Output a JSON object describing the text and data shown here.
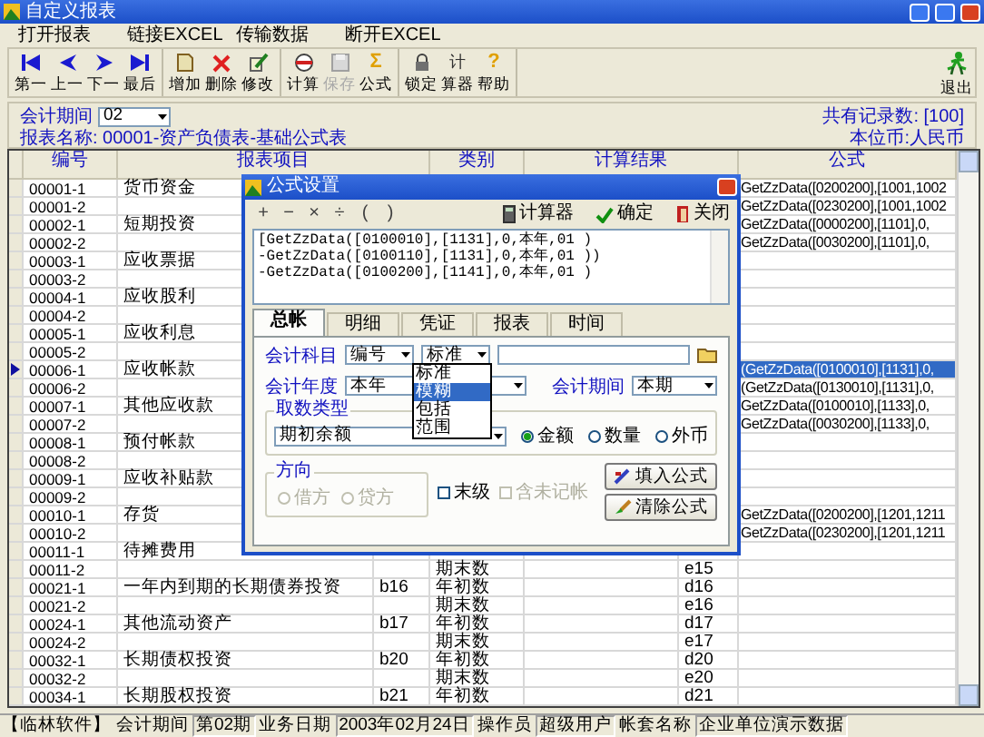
{
  "window": {
    "title": "自定义报表"
  },
  "menu": [
    "打开报表",
    "链接EXCEL",
    "传输数据",
    "断开EXCEL"
  ],
  "toolbar": {
    "groups": [
      [
        {
          "label": "第一",
          "disabled": false
        },
        {
          "label": "上一",
          "disabled": false
        },
        {
          "label": "下一",
          "disabled": false
        },
        {
          "label": "最后",
          "disabled": false
        }
      ],
      [
        {
          "label": "增加",
          "disabled": false
        },
        {
          "label": "删除",
          "disabled": false
        },
        {
          "label": "修改",
          "disabled": false
        }
      ],
      [
        {
          "label": "计算",
          "disabled": false
        },
        {
          "label": "保存",
          "disabled": true
        },
        {
          "label": "公式",
          "glyph": "Σ",
          "disabled": false
        }
      ],
      [
        {
          "label": "锁定",
          "disabled": false
        },
        {
          "label": "算器",
          "glyph": "计",
          "disabled": false
        },
        {
          "label": "帮助",
          "glyph": "?",
          "disabled": false
        }
      ]
    ],
    "exit": {
      "label": "退出"
    }
  },
  "info": {
    "period_label": "会计期间",
    "period": "02",
    "record_count": "共有记录数: [100]",
    "report_name": "报表名称: 00001-资产负债表-基础公式表",
    "currency": "本位币:人民币"
  },
  "table": {
    "columns": [
      "编号",
      "报表项目",
      "类别",
      "计算结果",
      "公式"
    ],
    "rows": [
      {
        "id": "00001-1",
        "item": "货币资金",
        "formula": "GetZzData([0200200],[1001,1002",
        "selected": false
      },
      {
        "id": "00001-2",
        "formula": "GetZzData([0230200],[1001,1002",
        "selected": false
      },
      {
        "id": "00002-1",
        "item": "短期投资",
        "formula": "GetZzData([0000200],[1101],0,",
        "selected": false
      },
      {
        "id": "00002-2",
        "formula": "GetZzData([0030200],[1101],0,",
        "selected": false
      },
      {
        "id": "00003-1",
        "item": "应收票据",
        "selected": false
      },
      {
        "id": "00003-2",
        "selected": false
      },
      {
        "id": "00004-1",
        "item": "应收股利",
        "selected": false
      },
      {
        "id": "00004-2",
        "selected": false
      },
      {
        "id": "00005-1",
        "item": "应收利息",
        "selected": false
      },
      {
        "id": "00005-2",
        "selected": false
      },
      {
        "id": "00006-1",
        "item": "应收帐款",
        "formula": "(GetZzData([0100010],[1131],0,",
        "selected": true
      },
      {
        "id": "00006-2",
        "formula": "(GetZzData([0130010],[1131],0,",
        "selected": false
      },
      {
        "id": "00007-1",
        "item": "其他应收款",
        "formula": "GetZzData([0100010],[1133],0,",
        "selected": false
      },
      {
        "id": "00007-2",
        "formula": "GetZzData([0030200],[1133],0,",
        "selected": false
      },
      {
        "id": "00008-1",
        "item": "预付帐款",
        "selected": false
      },
      {
        "id": "00008-2",
        "selected": false
      },
      {
        "id": "00009-1",
        "item": "应收补贴款",
        "selected": false
      },
      {
        "id": "00009-2",
        "selected": false
      },
      {
        "id": "00010-1",
        "item": "存货",
        "formula": "GetZzData([0200200],[1201,1211",
        "selected": false
      },
      {
        "id": "00010-2",
        "formula": "GetZzData([0230200],[1201,1211",
        "selected": false
      },
      {
        "id": "00011-1",
        "item": "待摊费用",
        "selected": false
      },
      {
        "id": "00011-2",
        "category": "期末数",
        "column_6": "e15",
        "selected": false
      },
      {
        "id": "00021-1",
        "item": "一年内到期的长期债券投资",
        "column_3": "b16",
        "category": "年初数",
        "column_6": "d16",
        "selected": false
      },
      {
        "id": "00021-2",
        "category": "期末数",
        "column_6": "e16",
        "selected": false
      },
      {
        "id": "00024-1",
        "item": "其他流动资产",
        "column_3": "b17",
        "category": "年初数",
        "column_6": "d17",
        "selected": false
      },
      {
        "id": "00024-2",
        "category": "期末数",
        "column_6": "e17",
        "selected": false
      },
      {
        "id": "00032-1",
        "item": "长期债权投资",
        "column_3": "b20",
        "category": "年初数",
        "column_6": "d20",
        "selected": false
      },
      {
        "id": "00032-2",
        "category": "期末数",
        "column_6": "e20",
        "selected": false
      },
      {
        "id": "00034-1",
        "item": "长期股权投资",
        "column_3": "b21",
        "category": "年初数",
        "column_6": "d21",
        "selected": false
      }
    ]
  },
  "dialog": {
    "title": "公式设置",
    "operators": [
      "+",
      "−",
      "×",
      "÷",
      "(",
      ")"
    ],
    "actions": [
      "计算器",
      "确定",
      "关闭"
    ],
    "formula_lines": [
      "[GetZzData([0100010],[1131],0,本年,01 )",
      "-GetZzData([0100110],[1131],0,本年,01 ))",
      "-GetZzData([0100200],[1141],0,本年,01 )"
    ],
    "tabs": [
      {
        "label": "总帐",
        "selected": true
      },
      {
        "label": "明细",
        "selected": false
      },
      {
        "label": "凭证",
        "selected": false
      },
      {
        "label": "报表",
        "selected": false
      },
      {
        "label": "时间",
        "selected": false
      }
    ],
    "account_label": "会计科目",
    "account_mode": "编号",
    "match_mode": "标准",
    "match_options": [
      {
        "label": "标准",
        "selected": false
      },
      {
        "label": "模糊",
        "selected": true
      },
      {
        "label": "包括",
        "selected": false
      },
      {
        "label": "范围",
        "selected": false
      }
    ],
    "year_label": "会计年度",
    "year": "本年",
    "period_label": "会计期间",
    "period": "本期",
    "fetch_type": {
      "title": "取数类型",
      "value": "期初余额",
      "options": [
        {
          "label": "金额",
          "selected": true
        },
        {
          "label": "数量",
          "selected": false
        },
        {
          "label": "外币",
          "selected": false
        }
      ]
    },
    "direction": {
      "title": "方向",
      "options": [
        {
          "label": "借方",
          "selected": false,
          "disabled": true
        },
        {
          "label": "贷方",
          "selected": false,
          "disabled": true
        }
      ]
    },
    "checks": [
      {
        "label": "末级",
        "checked": false,
        "disabled": false
      },
      {
        "label": "含未记帐",
        "checked": false,
        "disabled": true
      }
    ],
    "buttons": [
      "填入公式",
      "清除公式"
    ]
  },
  "status_bar": [
    {
      "text": "【临林软件】",
      "kind": "brand"
    },
    {
      "text": "会计期间",
      "kind": "label"
    },
    {
      "text": "第02期",
      "kind": "value"
    },
    {
      "text": "业务日期",
      "kind": "label"
    },
    {
      "text": "2003年02月24日",
      "kind": "value"
    },
    {
      "text": "操作员",
      "kind": "label"
    },
    {
      "text": "超级用户",
      "kind": "value"
    },
    {
      "text": "帐套名称",
      "kind": "label"
    },
    {
      "text": "企业单位演示数据",
      "kind": "value"
    }
  ]
}
